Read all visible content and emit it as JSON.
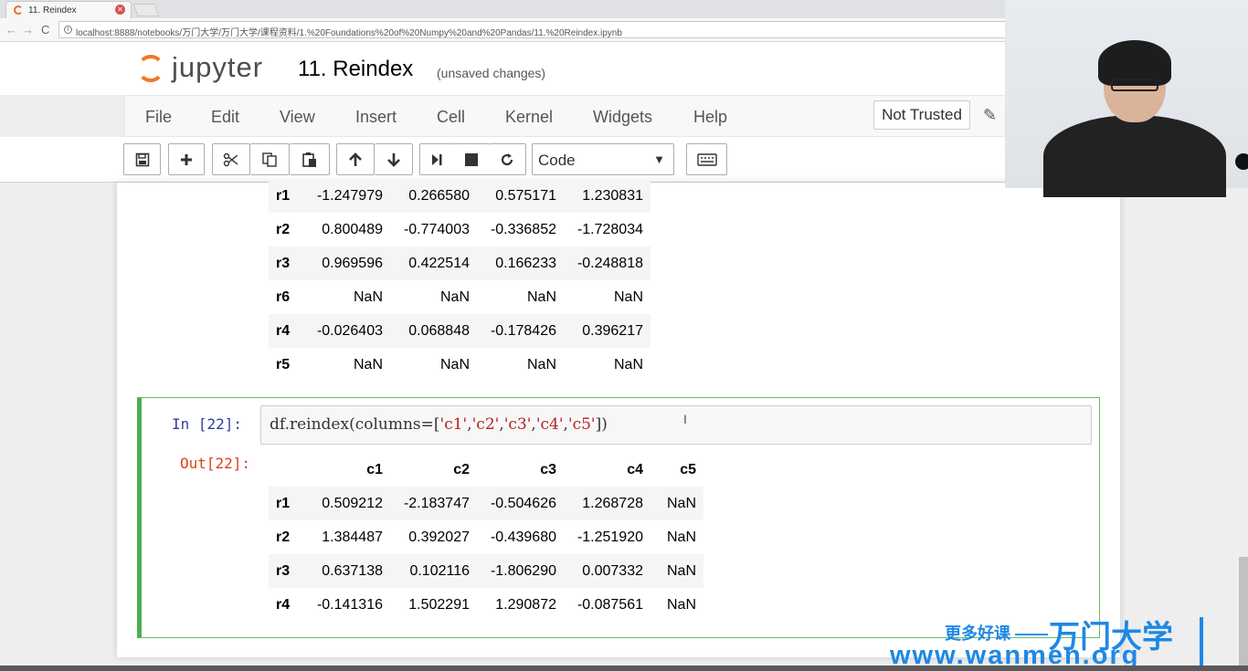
{
  "browser": {
    "tab_title": "11. Reindex",
    "tab_close": "✕",
    "url": "localhost:8888/notebooks/万门大学/万门大学/课程资料/1.%20Foundations%20of%20Numpy%20and%20Pandas/11.%20Reindex.ipynb",
    "back": "←",
    "forward": "→",
    "reload": "C"
  },
  "jupyter": {
    "logo": "jupyter",
    "notebook_title": "11. Reindex",
    "save_status": "(unsaved changes)",
    "menu": [
      "File",
      "Edit",
      "View",
      "Insert",
      "Cell",
      "Kernel",
      "Widgets",
      "Help"
    ],
    "trust": "Not Trusted",
    "cell_type": "Code",
    "toolbar_icons": [
      "save-icon",
      "plus-icon",
      "cut-icon",
      "copy-icon",
      "paste-icon",
      "arrow-up-icon",
      "arrow-down-icon",
      "run-icon",
      "stop-icon",
      "restart-icon",
      "keyboard-icon"
    ]
  },
  "output1": {
    "rows": [
      {
        "label": "r1",
        "values": [
          "-1.247979",
          "0.266580",
          "0.575171",
          "1.230831"
        ]
      },
      {
        "label": "r2",
        "values": [
          "0.800489",
          "-0.774003",
          "-0.336852",
          "-1.728034"
        ]
      },
      {
        "label": "r3",
        "values": [
          "0.969596",
          "0.422514",
          "0.166233",
          "-0.248818"
        ]
      },
      {
        "label": "r6",
        "values": [
          "NaN",
          "NaN",
          "NaN",
          "NaN"
        ]
      },
      {
        "label": "r4",
        "values": [
          "-0.026403",
          "0.068848",
          "-0.178426",
          "0.396217"
        ]
      },
      {
        "label": "r5",
        "values": [
          "NaN",
          "NaN",
          "NaN",
          "NaN"
        ]
      }
    ]
  },
  "cell22": {
    "in_prompt": "In  [22]:",
    "code_prefix": "df.reindex(columns=[",
    "code_strings": [
      "'c1'",
      "'c2'",
      "'c3'",
      "'c4'",
      "'c5'"
    ],
    "code_sep": ",",
    "code_suffix": "])",
    "out_prompt": "Out[22]:",
    "columns": [
      "c1",
      "c2",
      "c3",
      "c4",
      "c5"
    ],
    "rows": [
      {
        "label": "r1",
        "values": [
          "0.509212",
          "-2.183747",
          "-0.504626",
          "1.268728",
          "NaN"
        ]
      },
      {
        "label": "r2",
        "values": [
          "1.384487",
          "0.392027",
          "-0.439680",
          "-1.251920",
          "NaN"
        ]
      },
      {
        "label": "r3",
        "values": [
          "0.637138",
          "0.102116",
          "-1.806290",
          "0.007332",
          "NaN"
        ]
      },
      {
        "label": "r4",
        "values": [
          "-0.141316",
          "1.502291",
          "1.290872",
          "-0.087561",
          "NaN"
        ]
      }
    ]
  },
  "watermark": {
    "tagline": "更多好课 ——",
    "brand": "万门大学",
    "url": "www.wanmen.org"
  },
  "colors": {
    "accent_orange": "#f37726",
    "cell_border_green": "#4caf50",
    "in_prompt": "#303f9f",
    "out_prompt": "#d84315",
    "string": "#ba2121",
    "watermark_blue": "#1e88e5"
  }
}
